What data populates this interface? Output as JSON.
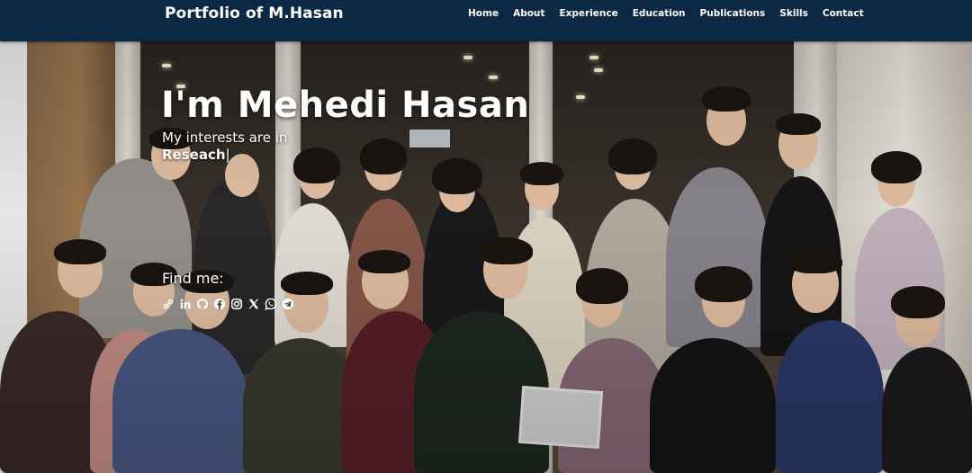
{
  "nav": {
    "brand": "Portfolio of M.Hasan",
    "links": [
      "Home",
      "About",
      "Experience",
      "Education",
      "Publications",
      "Skills",
      "Contact"
    ]
  },
  "hero": {
    "title": "I'm Mehedi Hasan",
    "interests_prefix": "My interests are in",
    "typed_text": "Reseach",
    "cursor": "|",
    "find_me": "Find me:"
  },
  "socials": [
    {
      "icon": "link-icon"
    },
    {
      "icon": "linkedin-icon"
    },
    {
      "icon": "github-icon"
    },
    {
      "icon": "facebook-icon"
    },
    {
      "icon": "instagram-icon"
    },
    {
      "icon": "x-twitter-icon"
    },
    {
      "icon": "whatsapp-icon"
    },
    {
      "icon": "telegram-icon"
    }
  ],
  "colors": {
    "navbar": "#0b2844",
    "text": "#ffffff"
  }
}
